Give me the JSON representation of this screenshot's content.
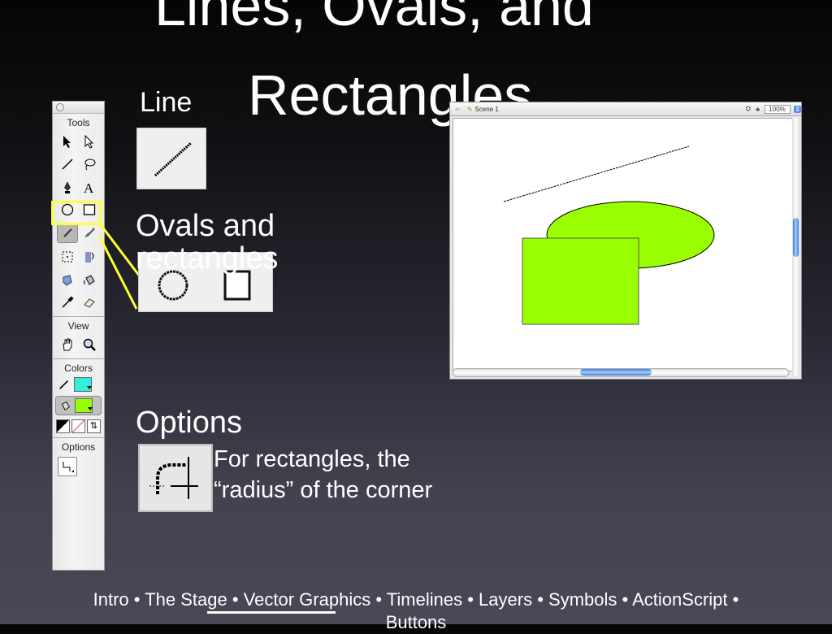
{
  "title": {
    "line1": "Lines, Ovals, and",
    "line2": "Rectangles"
  },
  "sections": {
    "line": "Line",
    "ovals": "Ovals and rectangles",
    "options": "Options",
    "options_desc": "For rectangles, the “radius” of the corner"
  },
  "tools_panel": {
    "header": "Tools",
    "view": "View",
    "colors": "Colors",
    "options": "Options",
    "tools": [
      "arrow-tool",
      "subselect-tool",
      "line-tool",
      "lasso-tool",
      "pen-tool",
      "text-tool",
      "oval-tool",
      "rectangle-tool",
      "pencil-tool",
      "brush-tool",
      "free-transform-tool",
      "fill-transform-tool",
      "ink-bottle-tool",
      "paint-bucket-tool",
      "eyedropper-tool",
      "eraser-tool"
    ],
    "stroke_color": "#33eedd",
    "fill_color": "#99ff00"
  },
  "stage_window": {
    "scene": "Scene 1",
    "zoom": "100%",
    "fill_color": "#99ff00"
  },
  "footer": {
    "items": [
      "Intro",
      "The Stage",
      "Vector Graphics",
      "Timelines",
      "Layers",
      "Symbols",
      "ActionScript",
      "Buttons"
    ],
    "separator": "•",
    "active": "Vector Graphics"
  }
}
